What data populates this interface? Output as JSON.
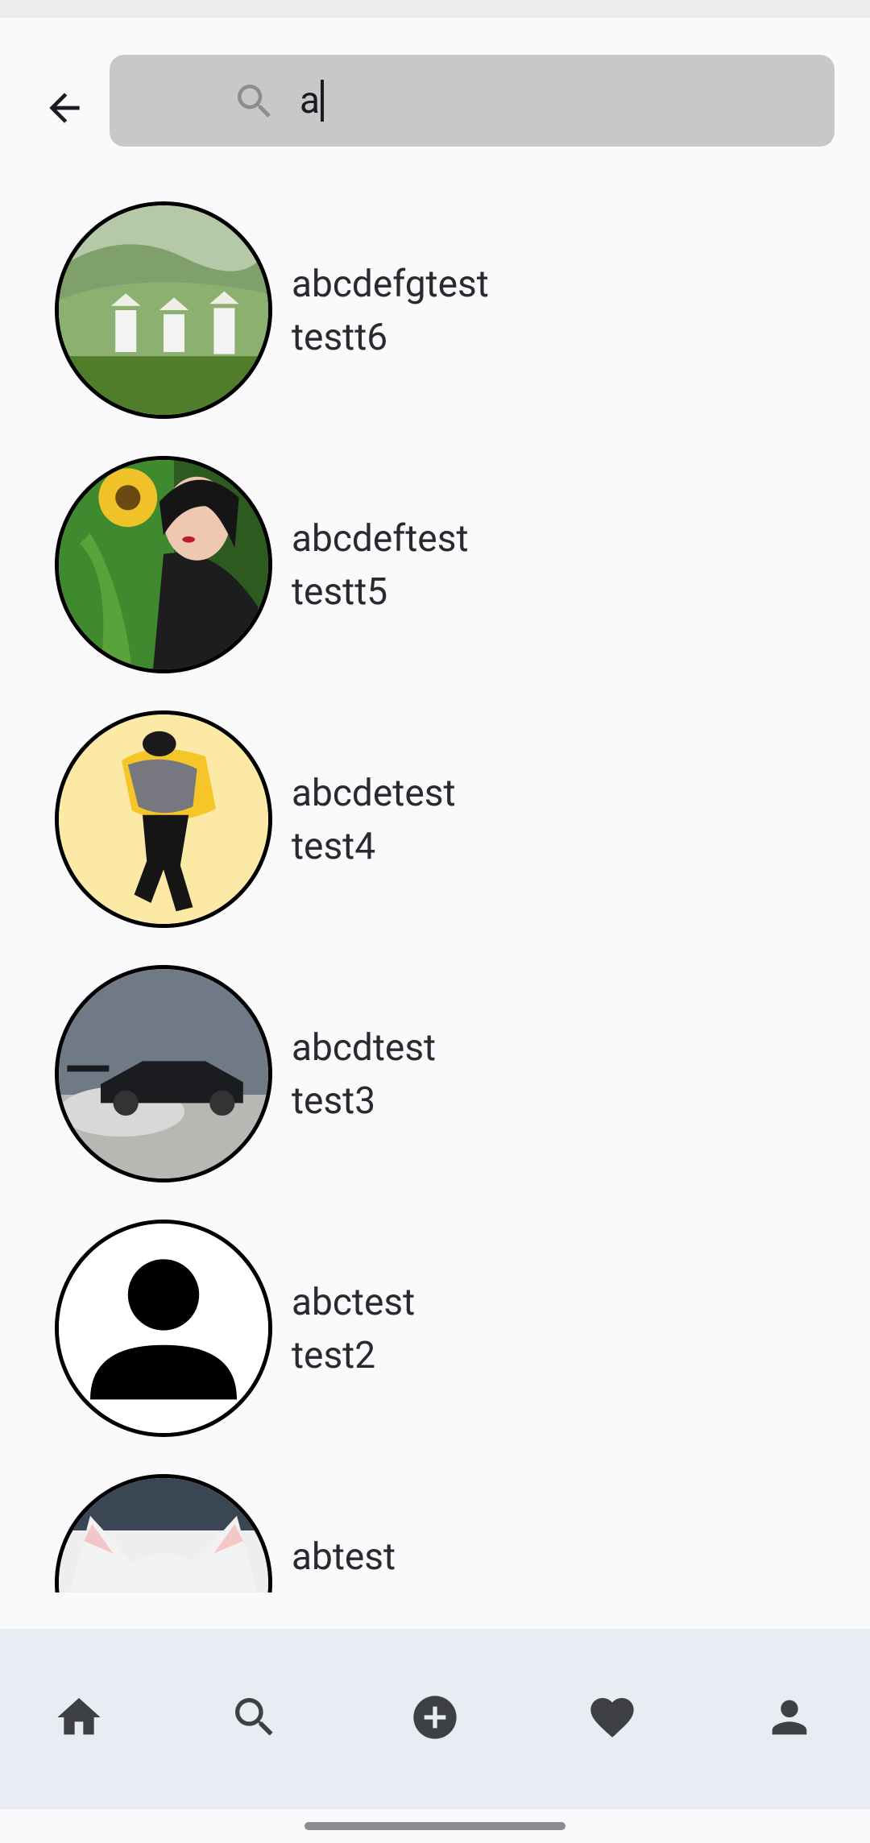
{
  "search": {
    "query": "a",
    "icon": "search-icon"
  },
  "header": {
    "back_icon": "arrow-back-icon"
  },
  "results": [
    {
      "username": "abcdefgtest",
      "display_name": "testt6",
      "avatar": "tea-pickers-photo"
    },
    {
      "username": "abcdeftest",
      "display_name": "testt5",
      "avatar": "woman-sunflower-photo"
    },
    {
      "username": "abcdetest",
      "display_name": "test4",
      "avatar": "dancer-yellow-photo"
    },
    {
      "username": "abcdtest",
      "display_name": "test3",
      "avatar": "drifting-car-photo"
    },
    {
      "username": "abctest",
      "display_name": "test2",
      "avatar": "default-person-icon"
    },
    {
      "username": "abtest",
      "display_name": "",
      "avatar": "white-cat-photo"
    }
  ],
  "bottom_nav": [
    {
      "icon": "home-icon"
    },
    {
      "icon": "search-icon"
    },
    {
      "icon": "add-circle-icon"
    },
    {
      "icon": "heart-icon"
    },
    {
      "icon": "person-icon"
    }
  ],
  "colors": {
    "background": "#fafafd",
    "search_field": "#c8c8ca",
    "nav_bar": "#e8edf4",
    "icon": "#3f4046",
    "text": "#2a2a2e"
  }
}
